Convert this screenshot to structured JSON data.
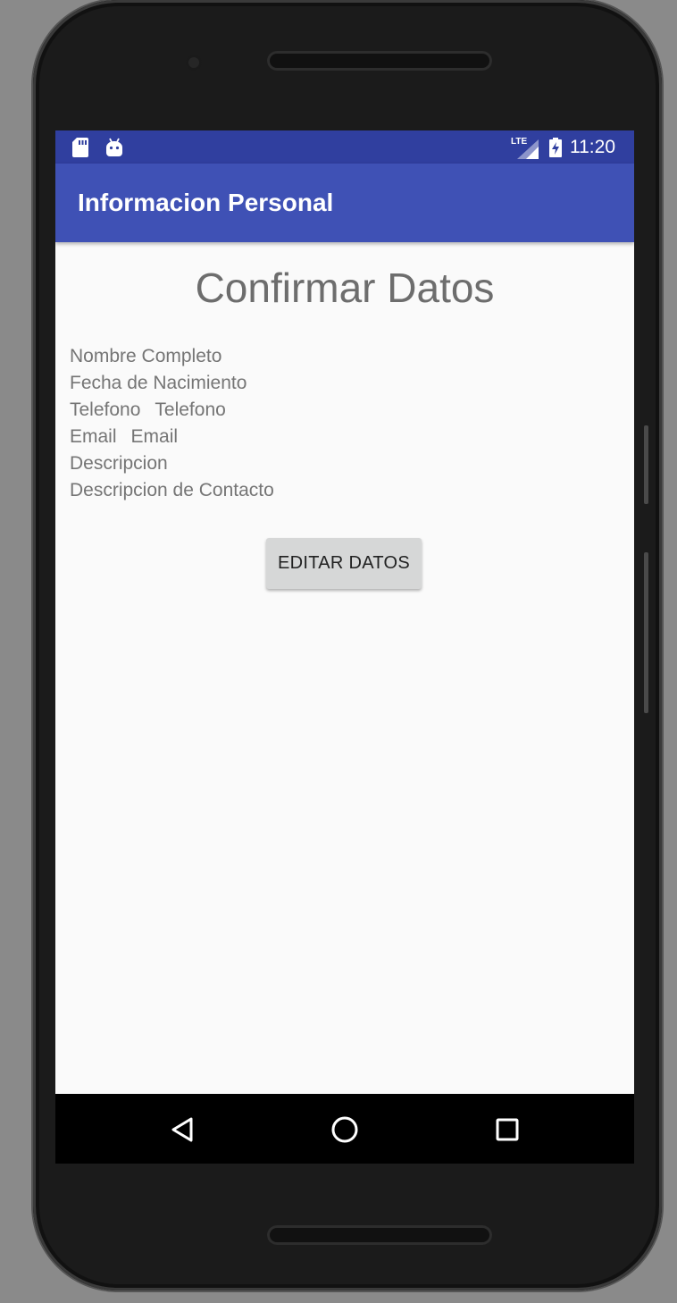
{
  "status_bar": {
    "time": "11:20",
    "network_label": "LTE",
    "icons": [
      "sd-card-icon",
      "android-icon",
      "lte-signal-icon",
      "battery-charging-icon"
    ]
  },
  "app_bar": {
    "title": "Informacion Personal",
    "color": "#3f51b5",
    "status_color": "#303f9f"
  },
  "main": {
    "heading": "Confirmar Datos",
    "fields": [
      {
        "label": "Nombre Completo"
      },
      {
        "label": "Fecha de Nacimiento"
      },
      {
        "label": "Telefono",
        "value": "Telefono"
      },
      {
        "label": "Email",
        "value": "Email"
      },
      {
        "label": "Descripcion"
      },
      {
        "label": "Descripcion de Contacto"
      }
    ],
    "edit_button_label": "EDITAR DATOS"
  },
  "nav_bar": {
    "buttons": [
      "back-icon",
      "home-icon",
      "recents-icon"
    ]
  }
}
